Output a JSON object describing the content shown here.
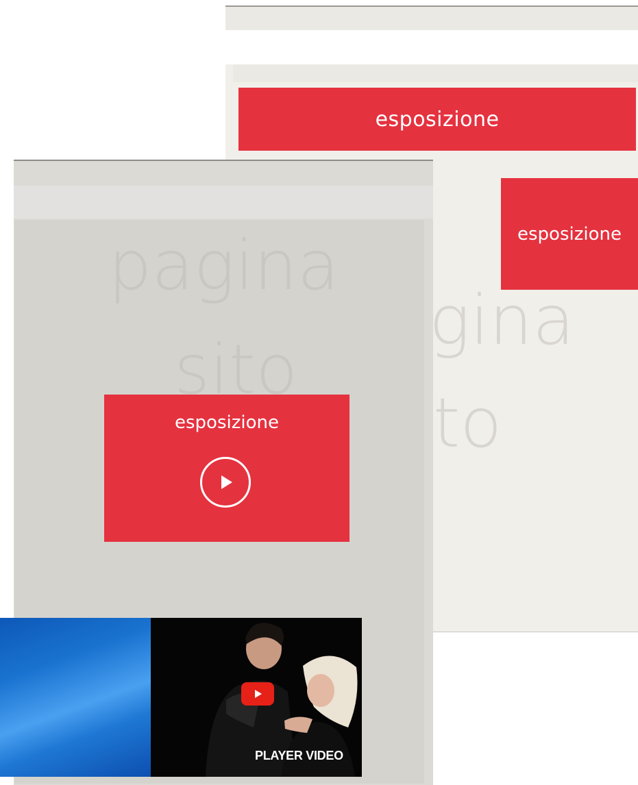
{
  "back_panel": {
    "banner_label": "esposizione",
    "tile_label": "esposizione",
    "ghost_text_1": "gina",
    "ghost_text_2": "to"
  },
  "front_panel": {
    "ghost_text_1": "pagina",
    "ghost_text_2": "sito",
    "card_label": "esposizione",
    "card_icon": "play-circle-icon"
  },
  "video": {
    "label": "PLAYER VIDEO",
    "play_icon": "youtube-play-icon"
  },
  "colors": {
    "accent_red": "#e5323f",
    "panel_bg_back": "#f1efea",
    "panel_bg_front": "#d5d3ce",
    "youtube_red": "#e62117"
  }
}
